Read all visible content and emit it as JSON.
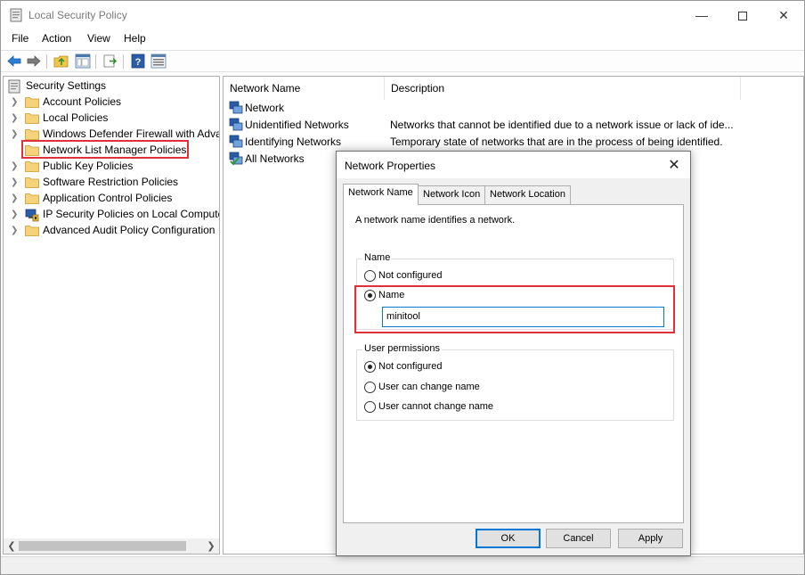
{
  "window": {
    "title": "Local Security Policy"
  },
  "menu": [
    "File",
    "Action",
    "View",
    "Help"
  ],
  "tree": {
    "root": "Security Settings",
    "items": [
      {
        "label": "Account Policies"
      },
      {
        "label": "Local Policies"
      },
      {
        "label": "Windows Defender Firewall with Adva"
      },
      {
        "label": "Network List Manager Policies"
      },
      {
        "label": "Public Key Policies"
      },
      {
        "label": "Software Restriction Policies"
      },
      {
        "label": "Application Control Policies"
      },
      {
        "label": "IP Security Policies on Local Compute"
      },
      {
        "label": "Advanced Audit Policy Configuration"
      }
    ]
  },
  "list": {
    "columns": {
      "name": "Network Name",
      "description": "Description"
    },
    "rows": [
      {
        "name": "Network",
        "description": ""
      },
      {
        "name": "Unidentified Networks",
        "description": "Networks that cannot be identified due to a network issue or lack of ide..."
      },
      {
        "name": "Identifying Networks",
        "description": "Temporary state of networks that are in the process of being identified."
      },
      {
        "name": "All Networks",
        "description": ""
      }
    ]
  },
  "dialog": {
    "title": "Network Properties",
    "tabs": [
      "Network Name",
      "Network Icon",
      "Network Location"
    ],
    "description": "A network name identifies a network.",
    "name_group": {
      "title": "Name",
      "option_not_configured": "Not configured",
      "option_name": "Name",
      "selected": "Name",
      "value": "minitool"
    },
    "permissions_group": {
      "title": "User permissions",
      "option_not_configured": "Not configured",
      "option_can_change": "User can change name",
      "option_cannot_change": "User cannot change name",
      "selected": "Not configured"
    },
    "buttons": {
      "ok": "OK",
      "cancel": "Cancel",
      "apply": "Apply"
    }
  },
  "colors": {
    "highlight": "#e0303a",
    "focus": "#0078d7"
  }
}
